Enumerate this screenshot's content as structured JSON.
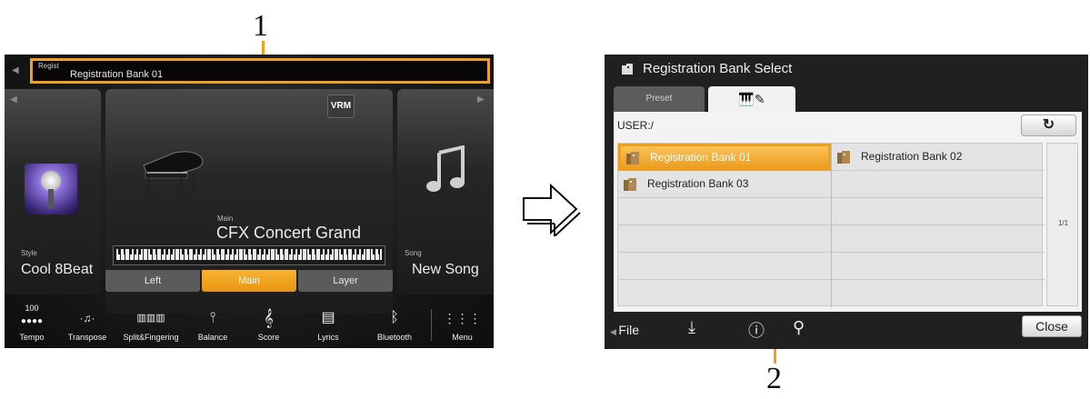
{
  "callouts": {
    "first": "1",
    "second": "2"
  },
  "home": {
    "regist": {
      "label": "Regist",
      "value": "Registration Bank 01"
    },
    "style": {
      "caption": "Style",
      "name": "Cool 8Beat"
    },
    "main": {
      "caption": "Main",
      "voice": "CFX Concert Grand",
      "vrm_label": "VRM"
    },
    "song": {
      "caption": "Song",
      "name": "New Song"
    },
    "parts": [
      "Left",
      "Main",
      "Layer"
    ],
    "toolbar": [
      {
        "value": "100",
        "label": "Tempo",
        "icon": "tempo-icon"
      },
      {
        "label": "Transpose",
        "icon": "transpose-icon"
      },
      {
        "label": "Split&Fingering",
        "icon": "split-fingering-icon"
      },
      {
        "label": "Balance",
        "icon": "balance-icon"
      },
      {
        "label": "Score",
        "icon": "score-icon"
      },
      {
        "label": "Lyrics",
        "icon": "lyrics-icon"
      },
      {
        "label": "Bluetooth",
        "icon": "bluetooth-icon"
      },
      {
        "label": "Menu",
        "icon": "menu-icon"
      }
    ]
  },
  "bank_select": {
    "title": "Registration Bank Select",
    "tabs": {
      "preset": "Preset"
    },
    "path": "USER:/",
    "files": [
      "Registration Bank 01",
      "Registration Bank 02",
      "Registration Bank 03"
    ],
    "page": "1/1",
    "toolbar": {
      "file": "File",
      "close": "Close"
    }
  },
  "colors": {
    "highlight": "#f0a020",
    "screen_bg": "#202020"
  }
}
